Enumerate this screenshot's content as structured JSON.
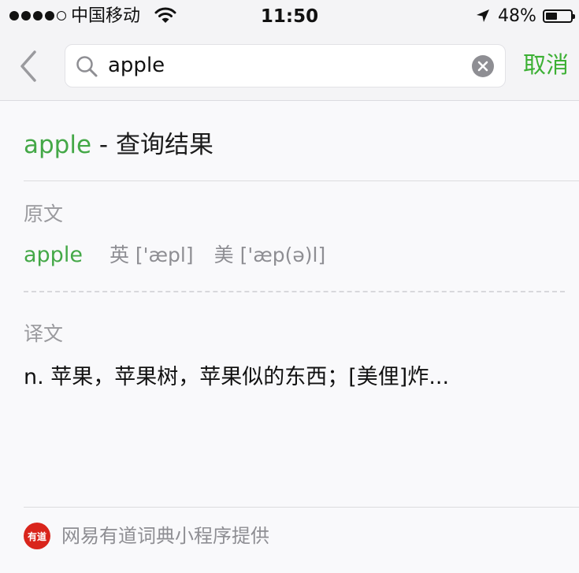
{
  "status_bar": {
    "carrier": "中国移动",
    "time": "11:50",
    "battery_percent": "48%",
    "battery_level": 0.48,
    "signal_bars_filled": 4,
    "signal_bars_total": 5
  },
  "search": {
    "query": "apple",
    "cancel_label": "取消"
  },
  "result": {
    "word": "apple",
    "separator": " - ",
    "title_suffix": "查询结果",
    "original_label": "原文",
    "original_word": "apple",
    "phonetic_uk": "英 ['æpl]",
    "phonetic_us": "美 ['æp(ə)l]",
    "translation_label": "译文",
    "translation": "n. 苹果，苹果树，苹果似的东西；[美俚]炸..."
  },
  "footer": {
    "logo_text": "有道",
    "text": "网易有道词典小程序提供"
  },
  "colors": {
    "accent_green": "#44a847",
    "cancel_green": "#3cb034",
    "muted_gray": "#8e8e93",
    "logo_red": "#d9251c"
  },
  "icons": {
    "back": "chevron-left-icon",
    "search": "search-icon",
    "clear": "clear-icon",
    "wifi": "wifi-icon",
    "location": "location-arrow-icon",
    "battery": "battery-icon"
  }
}
